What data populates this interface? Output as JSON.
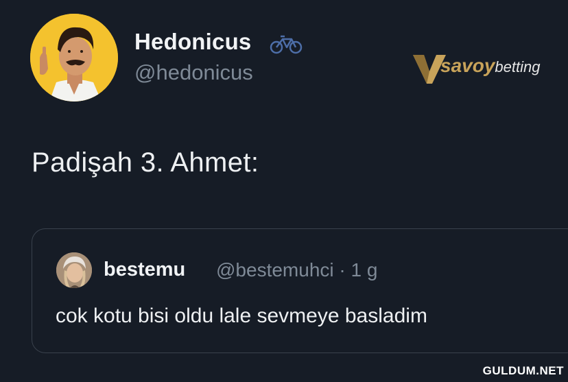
{
  "author": {
    "display_name": "Hedonicus",
    "handle": "@hedonicus",
    "avatar_icon": "profile-photo-icon",
    "badge_icon": "bicycle-icon"
  },
  "sponsor": {
    "brand": "savoy",
    "rest": "betting",
    "color": "#c8a35a"
  },
  "tweet": {
    "text": "Padişah 3. Ahmet:"
  },
  "quoted_tweet": {
    "display_name": "bestemu",
    "meta": "@bestemuhci · 1 g",
    "text": "cok kotu bisi oldu lale sevmeye basladim",
    "avatar_icon": "profile-photo-icon"
  },
  "watermark": "GULDUM.NET",
  "colors": {
    "background": "#161c26",
    "secondary_text": "#7f8a97",
    "border": "#3a424d"
  }
}
